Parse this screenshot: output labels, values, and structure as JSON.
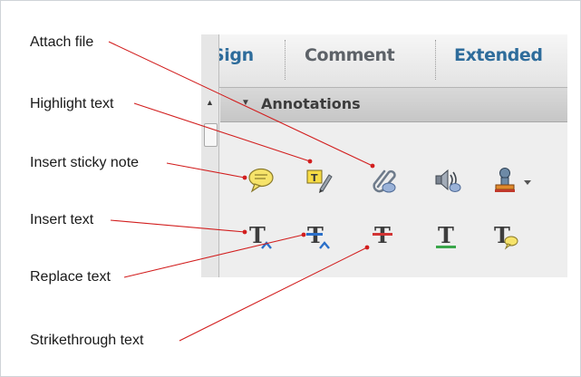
{
  "tabs": [
    "Sign",
    "Comment",
    "Extended"
  ],
  "panel": {
    "section_title": "Annotations",
    "tools_row1": [
      "speech-bubble-icon",
      "highlight-text-icon",
      "paperclip-icon",
      "speaker-icon",
      "stamp-icon"
    ],
    "tools_row2": [
      "insert-text-icon",
      "replace-text-icon",
      "strikethrough-icon",
      "underline-text-icon",
      "text-comment-icon"
    ]
  },
  "callouts": {
    "attach_file": "Attach file",
    "highlight_text": "Highlight text",
    "insert_sticky_note": "Insert sticky note",
    "insert_text": "Insert text",
    "replace_text": "Replace text",
    "strikethrough_text": "Strikethrough text"
  },
  "colors": {
    "leader_line": "#d21e1e",
    "tab_active_text": "#2e6c9b",
    "tab_text": "#5d6268"
  }
}
